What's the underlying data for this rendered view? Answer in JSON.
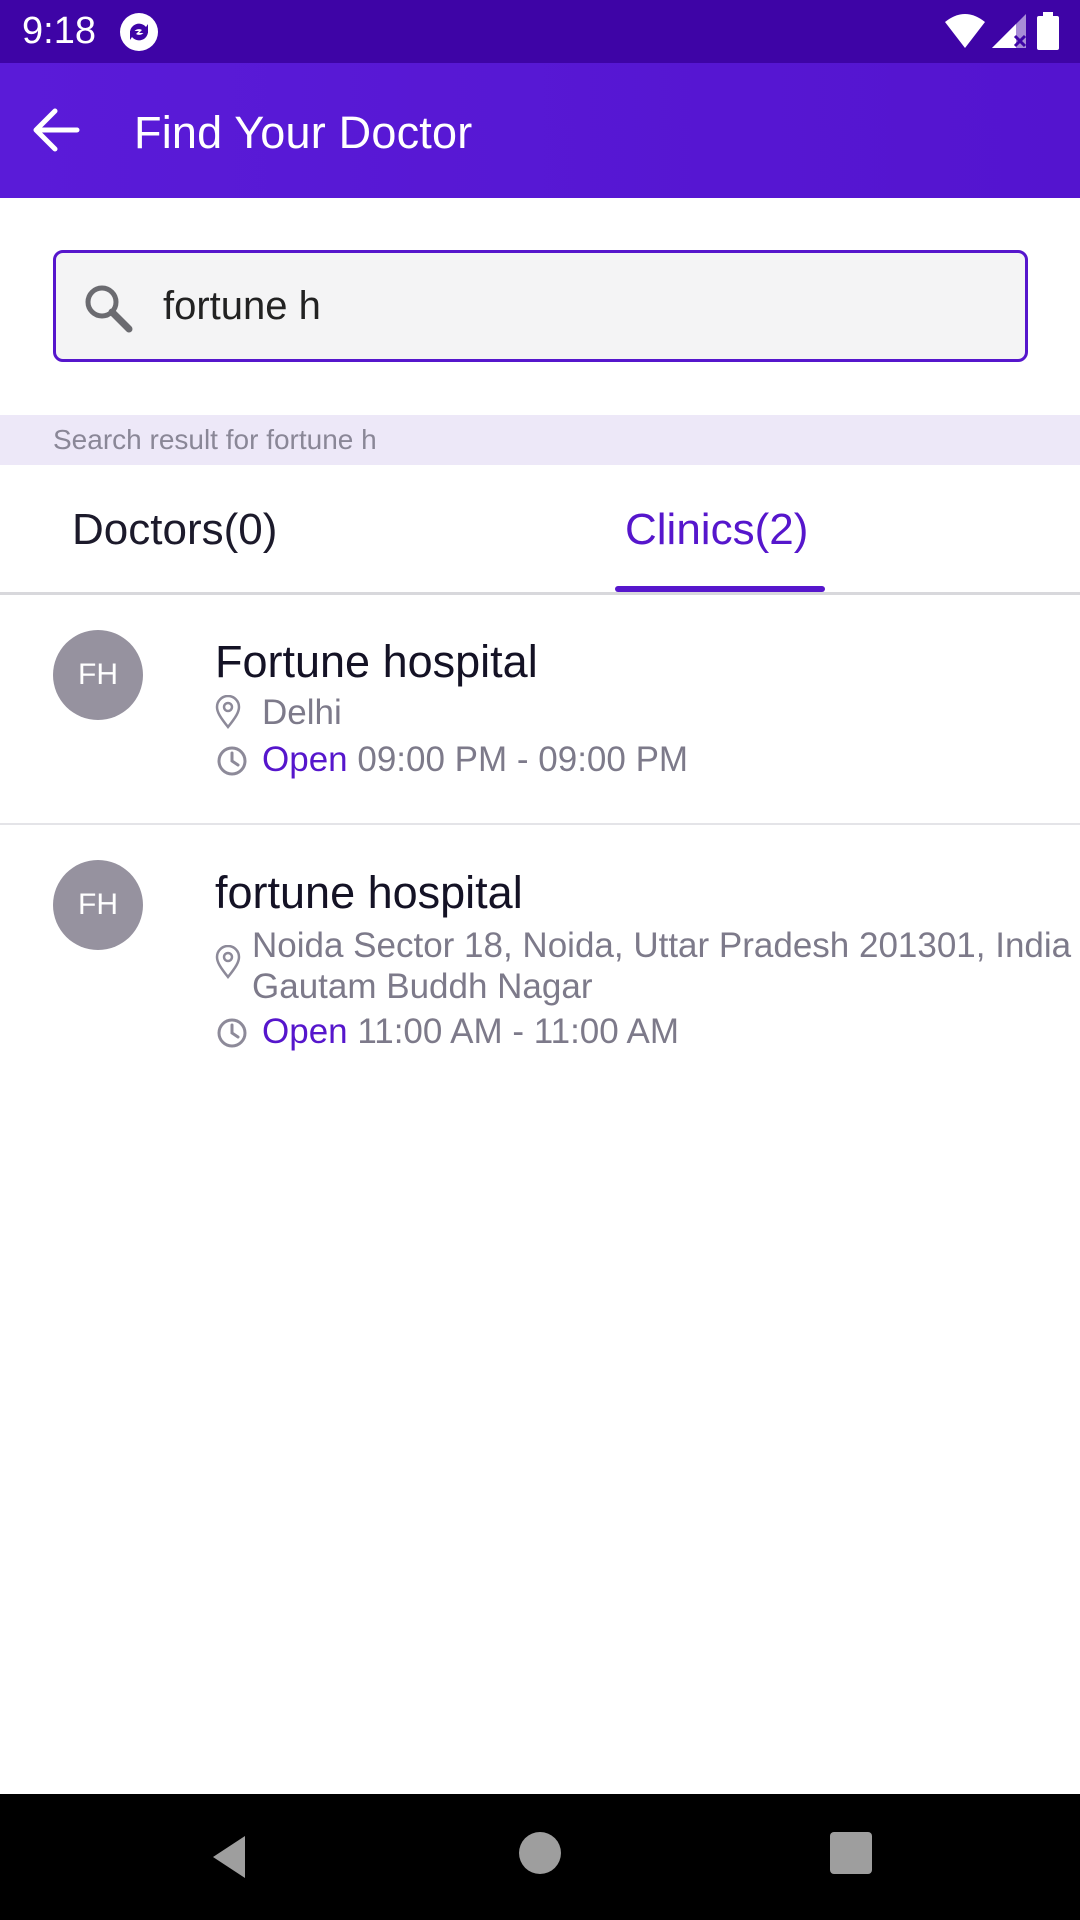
{
  "status_bar": {
    "time": "9:18",
    "icons": [
      "app-sync-icon",
      "wifi-icon",
      "signal-icon",
      "battery-icon"
    ]
  },
  "app_bar": {
    "title": "Find Your Doctor",
    "back_icon": "arrow-left-icon"
  },
  "search": {
    "value": "fortune h",
    "icon": "search-icon"
  },
  "result_label": "Search result for fortune h",
  "tabs": [
    {
      "label": "Doctors(0)",
      "selected": false
    },
    {
      "label": "Clinics(2)",
      "selected": true
    }
  ],
  "clinics": [
    {
      "initials": "FH",
      "name": "Fortune hospital",
      "location": "Delhi",
      "location_line2": "",
      "status": "Open",
      "hours": "09:00 PM - 09:00 PM"
    },
    {
      "initials": "FH",
      "name": "fortune hospital",
      "location": "Noida Sector 18, Noida, Uttar Pradesh 201301, India",
      "location_line2": "Gautam Buddh Nagar",
      "status": "Open",
      "hours": "11:00 AM - 11:00 AM"
    }
  ],
  "colors": {
    "status_bar": "#3e04a6",
    "app_bar": "#5a1bd8",
    "accent": "#5616cc",
    "avatar": "#96929f",
    "secondary_text": "#7d7a8a"
  }
}
